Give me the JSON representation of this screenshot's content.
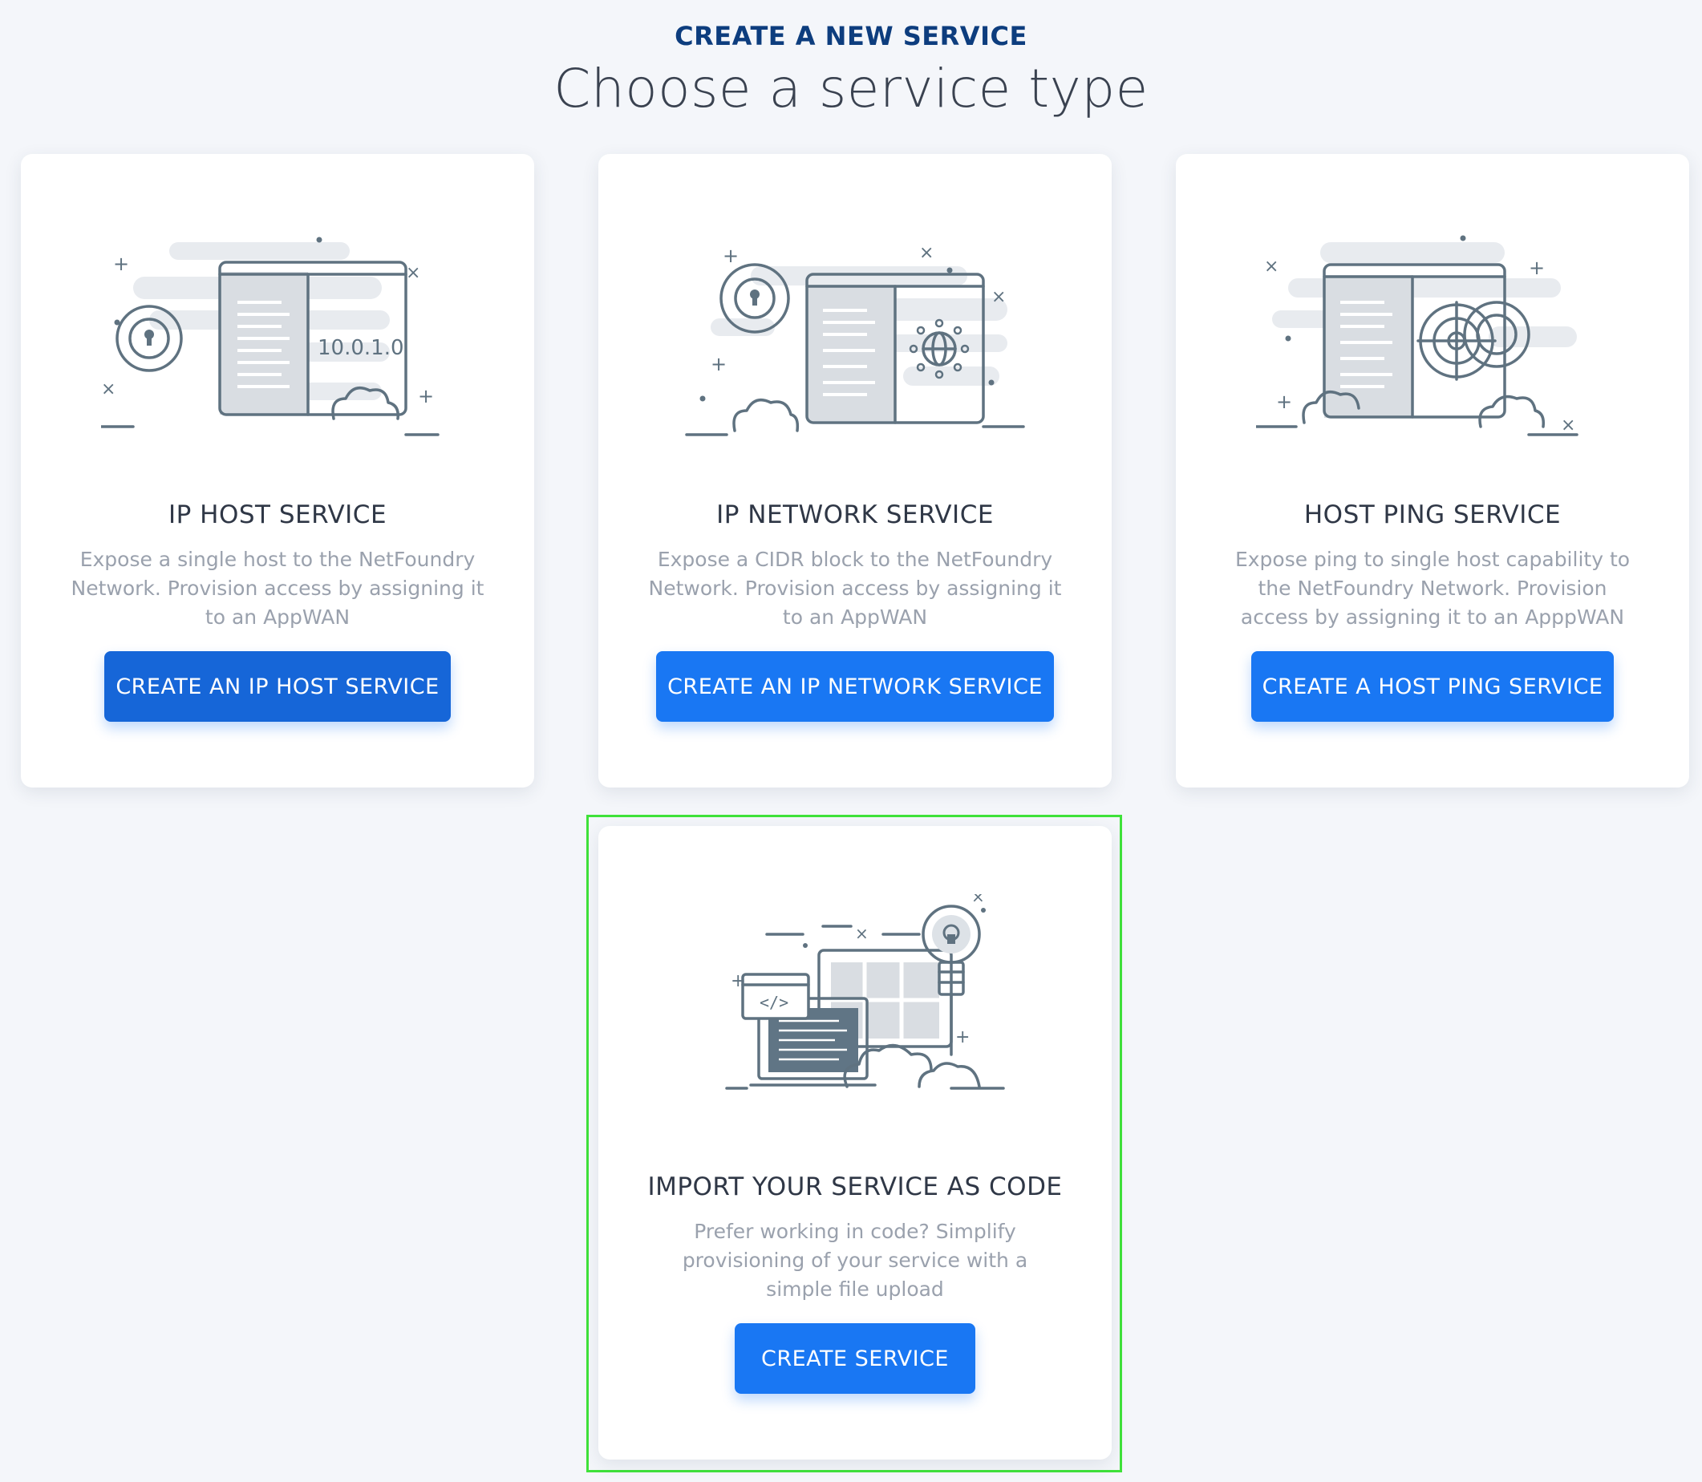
{
  "header": {
    "kicker": "CREATE A NEW SERVICE",
    "title": "Choose a service type"
  },
  "cards": [
    {
      "title": "IP HOST SERVICE",
      "description": "Expose a single host to the NetFoundry Network. Provision access by assigning it to an AppWAN",
      "button": "CREATE AN IP HOST SERVICE",
      "illustration_text": "10.0.1.0",
      "illustration_icon": "ip-host-server-icon"
    },
    {
      "title": "IP NETWORK SERVICE",
      "description": "Expose a CIDR block to the NetFoundry Network. Provision access by assigning it to an AppWAN",
      "button": "CREATE AN IP NETWORK SERVICE",
      "illustration_icon": "network-globe-server-icon"
    },
    {
      "title": "HOST PING SERVICE",
      "description": "Expose ping to single host capability to the NetFoundry Network. Provision access by assigning it to an ApppWAN",
      "button": "CREATE A HOST PING SERVICE",
      "illustration_icon": "radar-server-icon"
    },
    {
      "title": "IMPORT YOUR SERVICE AS CODE",
      "description": "Prefer working in code? Simplify provisioning of your service with a simple file upload",
      "button": "CREATE SERVICE",
      "illustration_text": "</>",
      "illustration_icon": "code-laptop-lightbulb-icon"
    }
  ],
  "colors": {
    "background": "#f4f6fa",
    "kicker": "#0d3d7e",
    "button": "#1977f3",
    "highlight": "#3fe23a",
    "illustration_stroke": "#5f7280"
  }
}
